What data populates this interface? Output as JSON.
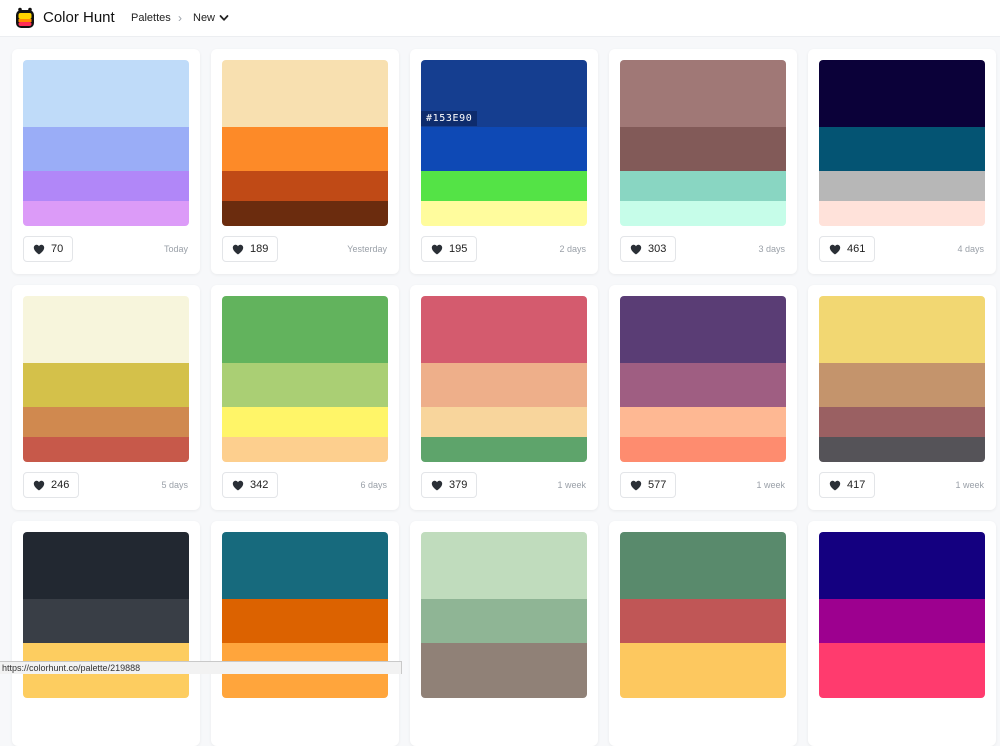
{
  "header": {
    "brand": "Color Hunt",
    "nav_palettes": "Palettes",
    "nav_separator": "›",
    "nav_new": "New"
  },
  "hover_hex": "#153E90",
  "status_url": "https://colorhunt.co/palette/219888",
  "palettes": [
    {
      "colors": [
        "#bfdbf9",
        "#9aadf7",
        "#b187f8",
        "#dc9bf8"
      ],
      "likes": "70",
      "date": "Today"
    },
    {
      "colors": [
        "#f8e0b0",
        "#fd8a28",
        "#c04a16",
        "#6b2c0e"
      ],
      "likes": "189",
      "date": "Yesterday"
    },
    {
      "colors": [
        "#153e90",
        "#0e49b5",
        "#54e346",
        "#fffc9d"
      ],
      "likes": "195",
      "date": "2 days"
    },
    {
      "colors": [
        "#a07876",
        "#825a58",
        "#89d6c2",
        "#c6fde9"
      ],
      "likes": "303",
      "date": "3 days"
    },
    {
      "colors": [
        "#0b0139",
        "#045473",
        "#b7b7b7",
        "#ffe2da"
      ],
      "likes": "461",
      "date": "4 days"
    },
    {
      "colors": [
        "#f7f5dc",
        "#d4c14a",
        "#d0894f",
        "#c7594a"
      ],
      "likes": "246",
      "date": "5 days"
    },
    {
      "colors": [
        "#62b35d",
        "#aacf74",
        "#fff568",
        "#fdcf8e"
      ],
      "likes": "342",
      "date": "6 days"
    },
    {
      "colors": [
        "#d45b6e",
        "#eeaf8a",
        "#f8d59c",
        "#5ea46b"
      ],
      "likes": "379",
      "date": "1 week"
    },
    {
      "colors": [
        "#5a3d75",
        "#9f5e82",
        "#feb893",
        "#fe8c6f"
      ],
      "likes": "577",
      "date": "1 week"
    },
    {
      "colors": [
        "#f2d772",
        "#c4946c",
        "#9a6062",
        "#555358"
      ],
      "likes": "417",
      "date": "1 week"
    },
    {
      "colors": [
        "#222831",
        "#393e46",
        "#fdcd60",
        "#fdcd60"
      ],
      "likes": "",
      "date": ""
    },
    {
      "colors": [
        "#176a7d",
        "#dc6200",
        "#ffa53c",
        "#ffa53c"
      ],
      "likes": "",
      "date": ""
    },
    {
      "colors": [
        "#c0dcbd",
        "#8fb595",
        "#908177",
        "#908177"
      ],
      "likes": "",
      "date": ""
    },
    {
      "colors": [
        "#598a6c",
        "#c05656",
        "#fdc85f",
        "#fdc85f"
      ],
      "likes": "",
      "date": ""
    },
    {
      "colors": [
        "#140080",
        "#9d008f",
        "#ff3b6e",
        "#ff3b6e"
      ],
      "likes": "",
      "date": ""
    }
  ]
}
